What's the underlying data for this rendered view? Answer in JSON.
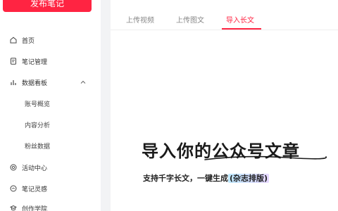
{
  "sidebar": {
    "publish_label": "发布笔记",
    "items": [
      {
        "label": "首页",
        "icon": "home-icon"
      },
      {
        "label": "笔记管理",
        "icon": "note-icon"
      },
      {
        "label": "数据看板",
        "icon": "chart-icon"
      },
      {
        "label": "账号概览",
        "icon": ""
      },
      {
        "label": "内容分析",
        "icon": ""
      },
      {
        "label": "粉丝数据",
        "icon": ""
      },
      {
        "label": "活动中心",
        "icon": "activity-icon"
      },
      {
        "label": "笔记灵感",
        "icon": "inspiration-icon"
      },
      {
        "label": "创作学院",
        "icon": "academy-icon"
      }
    ]
  },
  "main": {
    "tabs": [
      {
        "label": "上传视频"
      },
      {
        "label": "上传图文"
      },
      {
        "label": "导入长文",
        "active": true
      }
    ],
    "promo": {
      "title": "导入你的公众号文章",
      "subtitle_prefix": "支持千字长文，一键生成",
      "subtitle_highlight": "(杂志排版)"
    }
  },
  "colors": {
    "accent": "#ff2442",
    "background": "#f2f3f5",
    "panel": "#ffffff"
  }
}
